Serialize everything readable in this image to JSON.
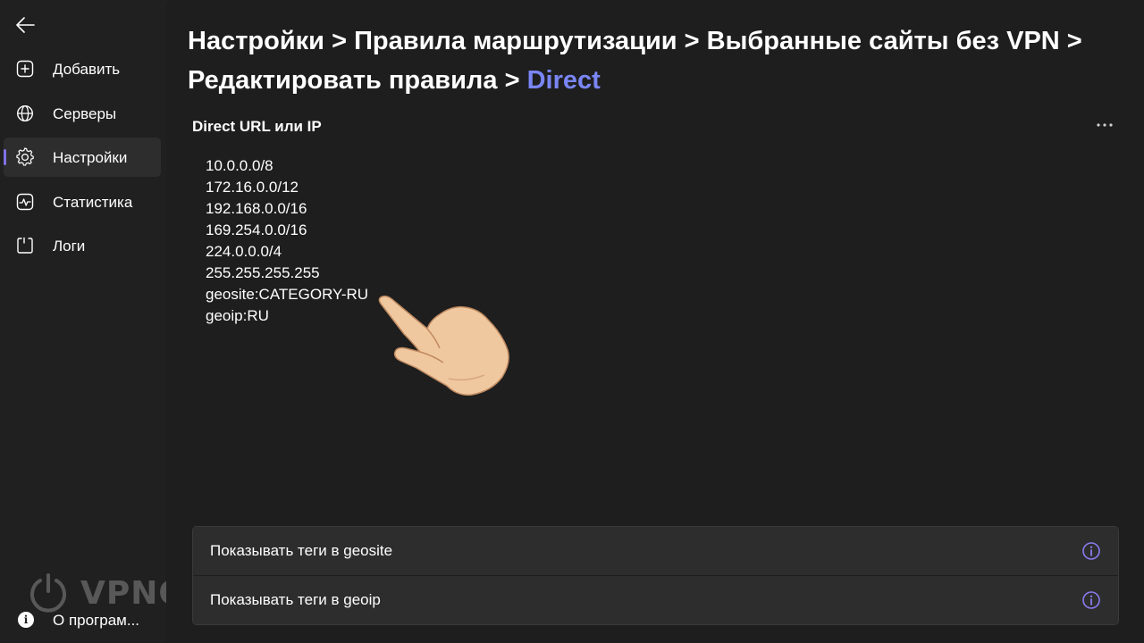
{
  "sidebar": {
    "back_icon": "arrow-left-icon",
    "items": [
      {
        "label": "Добавить",
        "icon": "plus-square-icon",
        "active": false
      },
      {
        "label": "Серверы",
        "icon": "globe-icon",
        "active": false
      },
      {
        "label": "Настройки",
        "icon": "gear-icon",
        "active": true
      },
      {
        "label": "Статистика",
        "icon": "chart-icon",
        "active": false
      },
      {
        "label": "Логи",
        "icon": "log-icon",
        "active": false
      }
    ],
    "about_label": "О програм...",
    "about_icon": "info-icon",
    "watermark": "VPNON"
  },
  "breadcrumb": {
    "items": [
      "Настройки",
      "Правила маршрутизации",
      "Выбранные сайты без VPN",
      "Редактировать правила"
    ],
    "separator": ">",
    "current": "Direct"
  },
  "section": {
    "title": "Direct URL или IP",
    "more_icon": "more-horizontal-icon"
  },
  "rules": [
    "10.0.0.0/8",
    "172.16.0.0/12",
    "192.168.0.0/16",
    "169.254.0.0/16",
    "224.0.0.0/4",
    "255.255.255.255",
    "geosite:CATEGORY-RU",
    "geoip:RU"
  ],
  "options": [
    {
      "label": "Показывать теги в geosite",
      "icon": "info-circle-icon"
    },
    {
      "label": "Показывать теги в geoip",
      "icon": "info-circle-icon"
    }
  ],
  "colors": {
    "accent": "#7f72e6",
    "breadcrumb_current": "#7a86f5",
    "info_icon": "#8a7cf0",
    "background": "#202020",
    "card": "#2d2d2d"
  }
}
